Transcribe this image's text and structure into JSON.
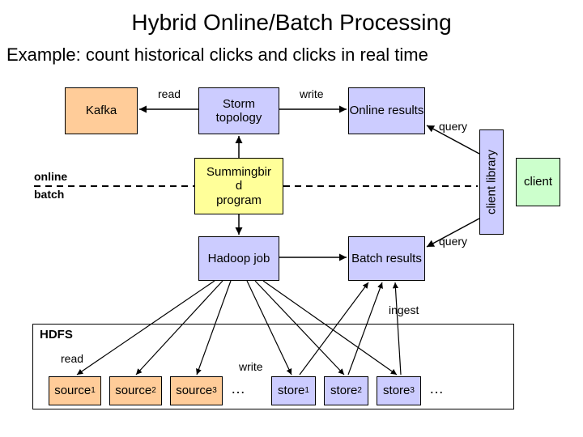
{
  "title": "Hybrid Online/Batch Processing",
  "subtitle": "Example: count historical clicks and clicks in real time",
  "boxes": {
    "kafka": "Kafka",
    "storm": "Storm topology",
    "online_results": "Online results",
    "summingbird": "Summingbir\nd\nprogram",
    "hadoop": "Hadoop job",
    "batch_results": "Batch results",
    "client_library": "client library",
    "client": "client",
    "hdfs": "HDFS",
    "source1_a": "source",
    "source1_b": "1",
    "source2_a": "source",
    "source2_b": "2",
    "source3_a": "source",
    "source3_b": "3",
    "store1_a": "store",
    "store1_b": "1",
    "store2_a": "store",
    "store2_b": "2",
    "store3_a": "store",
    "store3_b": "3"
  },
  "labels": {
    "read_top": "read",
    "write_top": "write",
    "query1": "query",
    "query2": "query",
    "online": "online",
    "batch": "batch",
    "ingest": "ingest",
    "read_bottom": "read",
    "write_bottom": "write",
    "dots1": "…",
    "dots2": "…"
  }
}
